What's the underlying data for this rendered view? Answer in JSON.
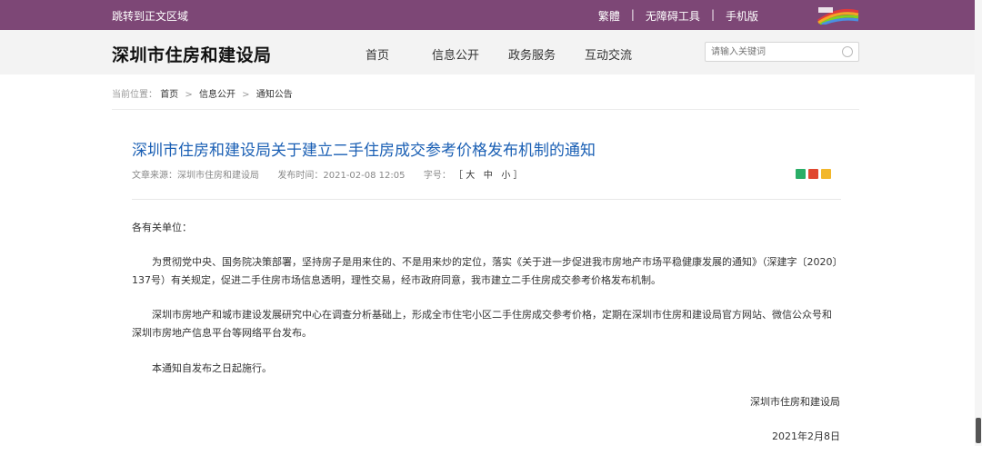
{
  "topbar": {
    "skip_link": "跳转到正文区域",
    "traditional": "繁體",
    "separator": "|",
    "accessibility": "无障碍工具",
    "mobile": "手机版"
  },
  "header": {
    "site_title": "深圳市住房和建设局",
    "nav": [
      "首页",
      "信息公开",
      "政务服务",
      "互动交流"
    ],
    "search_placeholder": "请输入关键词"
  },
  "breadcrumb": {
    "label": "当前位置：",
    "items": [
      "首页",
      "信息公开",
      "通知公告"
    ],
    "arrow": ">"
  },
  "article": {
    "title": "深圳市住房和建设局关于建立二手住房成交参考价格发布机制的通知",
    "source_label": "文章来源：",
    "source": "深圳市住房和建设局",
    "date_label": "发布时间：",
    "date": "2021-02-08 12:05",
    "fontsize_label": "字号：",
    "fontsize_open": "［",
    "fs_large": "大",
    "fs_medium": "中",
    "fs_small": "小",
    "fontsize_close": "］",
    "salutation": "各有关单位：",
    "paragraphs": [
      "为贯彻党中央、国务院决策部署，坚持房子是用来住的、不是用来炒的定位，落实《关于进一步促进我市房地产市场平稳健康发展的通知》（深建字〔2020〕137号）有关规定，促进二手住房市场信息透明，理性交易，经市政府同意，我市建立二手住房成交参考价格发布机制。",
      "深圳市房地产和城市建设发展研究中心在调查分析基础上，形成全市住宅小区二手住房成交参考价格，定期在深圳市住房和建设局官方网站、微信公众号和深圳市房地产信息平台等网络平台发布。",
      "本通知自发布之日起施行。"
    ],
    "signature_org": "深圳市住房和建设局",
    "signature_date": "2021年2月8日"
  },
  "colors": {
    "topbar": "#7d4776",
    "title_blue": "#1a5fb4"
  }
}
